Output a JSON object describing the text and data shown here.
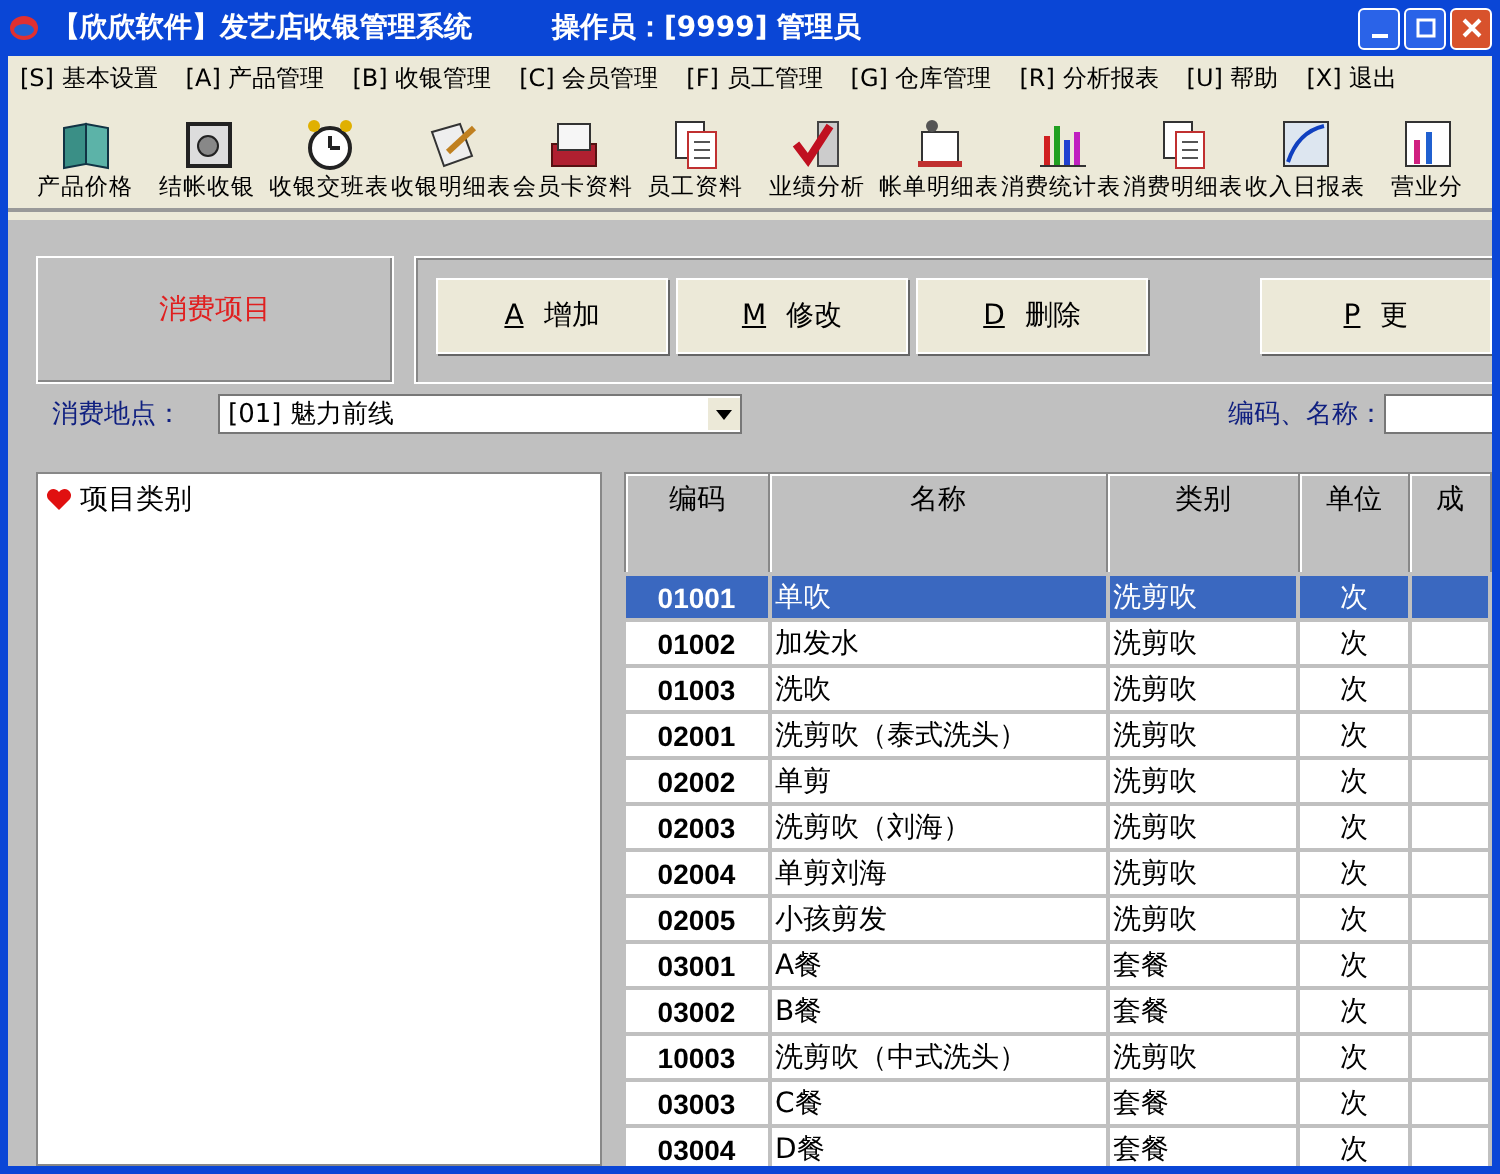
{
  "window": {
    "title": "【欣欣软件】发艺店收银管理系统",
    "operator": "操作员：[9999] 管理员"
  },
  "menu": [
    "[S] 基本设置",
    "[A] 产品管理",
    "[B] 收银管理",
    "[C] 会员管理",
    "[F] 员工管理",
    "[G] 仓库管理",
    "[R] 分析报表",
    "[U] 帮助",
    "[X] 退出"
  ],
  "toolbar": [
    "产品价格",
    "结帐收银",
    "收银交班表",
    "收银明细表",
    "会员卡资料",
    "员工资料",
    "业绩分析",
    "帐单明细表",
    "消费统计表",
    "消费明细表",
    "收入日报表",
    "营业分"
  ],
  "panel_title": "消费项目",
  "buttons": [
    {
      "key": "A",
      "label": "增加"
    },
    {
      "key": "M",
      "label": "修改"
    },
    {
      "key": "D",
      "label": "删除"
    },
    {
      "key": "P",
      "label": "更"
    }
  ],
  "filter": {
    "location_label": "消费地点：",
    "location_value": "[01] 魅力前线",
    "search_label": "编码、名称："
  },
  "tree": {
    "label": "项目类别"
  },
  "table": {
    "columns": [
      "编码",
      "名称",
      "类别",
      "单位",
      "成"
    ],
    "rows": [
      {
        "cells": [
          "01001",
          "单吹",
          "洗剪吹",
          "次"
        ],
        "selected": true
      },
      {
        "cells": [
          "01002",
          "加发水",
          "洗剪吹",
          "次"
        ],
        "selected": false
      },
      {
        "cells": [
          "01003",
          "洗吹",
          "洗剪吹",
          "次"
        ],
        "selected": false
      },
      {
        "cells": [
          "02001",
          "洗剪吹（泰式洗头）",
          "洗剪吹",
          "次"
        ],
        "selected": false
      },
      {
        "cells": [
          "02002",
          "单剪",
          "洗剪吹",
          "次"
        ],
        "selected": false
      },
      {
        "cells": [
          "02003",
          "洗剪吹（刘海）",
          "洗剪吹",
          "次"
        ],
        "selected": false
      },
      {
        "cells": [
          "02004",
          "单剪刘海",
          "洗剪吹",
          "次"
        ],
        "selected": false
      },
      {
        "cells": [
          "02005",
          "小孩剪发",
          "洗剪吹",
          "次"
        ],
        "selected": false
      },
      {
        "cells": [
          "03001",
          "A餐",
          "套餐",
          "次"
        ],
        "selected": false
      },
      {
        "cells": [
          "03002",
          "B餐",
          "套餐",
          "次"
        ],
        "selected": false
      },
      {
        "cells": [
          "10003",
          "洗剪吹（中式洗头）",
          "洗剪吹",
          "次"
        ],
        "selected": false
      },
      {
        "cells": [
          "03003",
          "C餐",
          "套餐",
          "次"
        ],
        "selected": false
      },
      {
        "cells": [
          "03004",
          "D餐",
          "套餐",
          "次"
        ],
        "selected": false
      }
    ]
  }
}
